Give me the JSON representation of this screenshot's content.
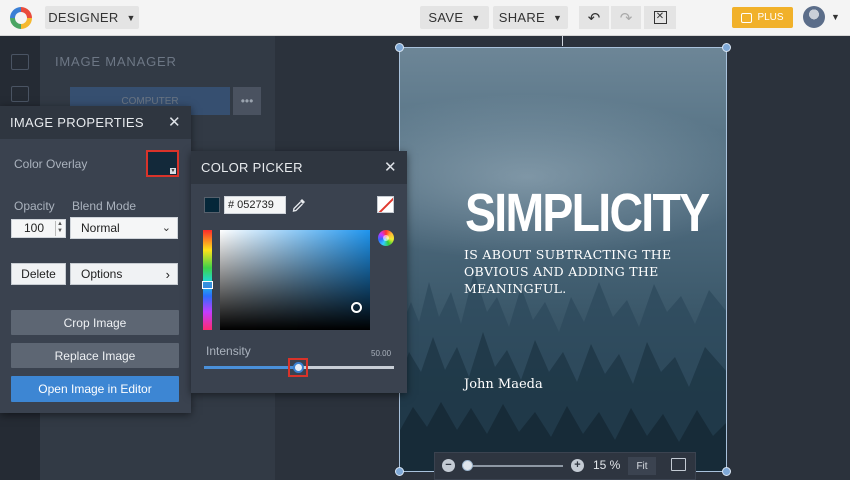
{
  "topbar": {
    "mode_label": "DESIGNER",
    "save_label": "SAVE",
    "share_label": "SHARE",
    "plus_label": "PLUS",
    "icons": [
      "logo-icon",
      "undo-icon",
      "redo-icon",
      "close-icon",
      "crown-icon",
      "avatar"
    ]
  },
  "background_panel": {
    "title": "IMAGE MANAGER",
    "computer_label": "COMPUTER",
    "more_label": "•••"
  },
  "image_properties": {
    "title": "IMAGE PROPERTIES",
    "color_overlay_label": "Color Overlay",
    "opacity_label": "Opacity",
    "opacity_value": "100",
    "blend_mode_label": "Blend Mode",
    "blend_mode_value": "Normal",
    "delete_label": "Delete",
    "options_label": "Options",
    "crop_label": "Crop Image",
    "replace_label": "Replace Image",
    "open_editor_label": "Open Image in Editor",
    "overlay_color": "#13293a"
  },
  "color_picker": {
    "title": "COLOR PICKER",
    "hex_value": "# 052739",
    "current_color": "#052739",
    "intensity_label": "Intensity",
    "intensity_value": "50.00",
    "intensity_fraction": 0.5
  },
  "poster": {
    "title": "SIMPLICITY",
    "subtitle": "IS ABOUT SUBTRACTING THE OBVIOUS AND ADDING THE MEANINGFUL.",
    "author": "John Maeda"
  },
  "zoom": {
    "minus": "−",
    "plus": "+",
    "value": "15 %",
    "fit_label": "Fit",
    "level_fraction": 0.05
  },
  "colors": {
    "accent_blue": "#3d86d3",
    "highlight_red": "#d9332a",
    "plus_gold": "#f1b12a"
  }
}
